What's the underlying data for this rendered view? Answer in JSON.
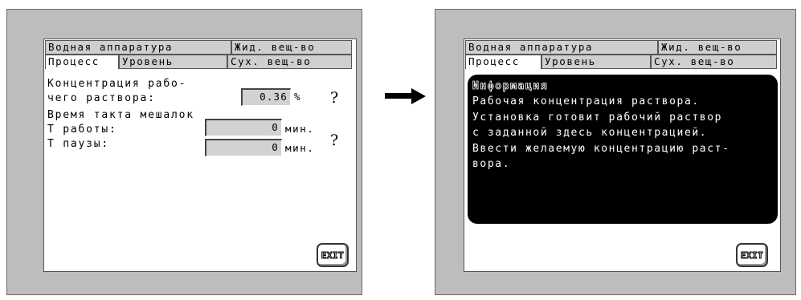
{
  "tabs": {
    "water": "Водная аппаратура",
    "liquid": "Жид. вещ-во",
    "process": "Процесс",
    "level": "Уровень",
    "dry": "Сух. вещ-во"
  },
  "left": {
    "concentration_label_1": "Концентрация рабо-",
    "concentration_label_2": "чего раствора:",
    "concentration_value": "0.36",
    "concentration_unit": "%",
    "cycle_label": "Время такта мешалок",
    "work_label": "Т работы:",
    "work_value": "0",
    "pause_label": "Т паузы:",
    "pause_value": "0",
    "time_unit": "мин.",
    "help_glyph": "?",
    "exit_label": "EXIT"
  },
  "right": {
    "info_title": "Информация",
    "info_lines": [
      "Рабочая концентрация раствора.",
      "Установка готовит рабочий раствор",
      "с заданной здесь концентрацией.",
      "Ввести желаемую концентрацию раст-",
      "вора."
    ],
    "exit_label": "EXIT"
  },
  "colors": {
    "bezel": "#bdbdbd",
    "tab_inactive": "#cfcfcf",
    "field": "#d2d2d2",
    "info_bg": "#000000"
  },
  "icons": {
    "arrow": "right-arrow-icon",
    "help": "question-mark-icon"
  }
}
